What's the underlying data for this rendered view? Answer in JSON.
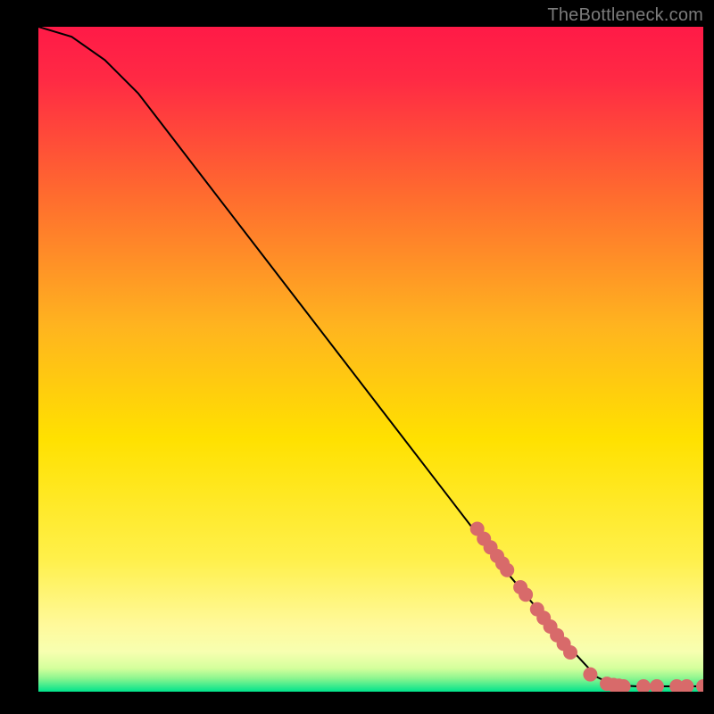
{
  "attribution": "TheBottleneck.com",
  "chart_data": {
    "type": "line",
    "title": "",
    "xlabel": "",
    "ylabel": "",
    "xlim": [
      0,
      100
    ],
    "ylim": [
      0,
      100
    ],
    "background": {
      "top_color": "#ff1a47",
      "mid_color": "#ffe100",
      "bottom_colors": [
        "#fff99b",
        "#b7f97a",
        "#00e38c"
      ]
    },
    "curve": {
      "description": "Monotonically decreasing curve from top-left to a flat plateau at bottom-right",
      "points": [
        {
          "x": 0.0,
          "y": 100.0
        },
        {
          "x": 5.0,
          "y": 98.5
        },
        {
          "x": 10.0,
          "y": 95.0
        },
        {
          "x": 15.0,
          "y": 90.0
        },
        {
          "x": 20.0,
          "y": 83.5
        },
        {
          "x": 30.0,
          "y": 70.5
        },
        {
          "x": 40.0,
          "y": 57.5
        },
        {
          "x": 50.0,
          "y": 44.5
        },
        {
          "x": 60.0,
          "y": 31.5
        },
        {
          "x": 70.0,
          "y": 18.5
        },
        {
          "x": 80.0,
          "y": 6.5
        },
        {
          "x": 84.0,
          "y": 2.2
        },
        {
          "x": 86.5,
          "y": 1.0
        },
        {
          "x": 90.0,
          "y": 0.8
        },
        {
          "x": 95.0,
          "y": 0.8
        },
        {
          "x": 100.0,
          "y": 0.8
        }
      ]
    },
    "markers": {
      "color": "#d86a6a",
      "radius_px": 8,
      "points": [
        {
          "x": 66.0,
          "y": 24.5
        },
        {
          "x": 67.0,
          "y": 23.0
        },
        {
          "x": 68.0,
          "y": 21.7
        },
        {
          "x": 69.0,
          "y": 20.4
        },
        {
          "x": 69.8,
          "y": 19.3
        },
        {
          "x": 70.5,
          "y": 18.3
        },
        {
          "x": 72.5,
          "y": 15.7
        },
        {
          "x": 73.3,
          "y": 14.6
        },
        {
          "x": 75.0,
          "y": 12.4
        },
        {
          "x": 76.0,
          "y": 11.1
        },
        {
          "x": 77.0,
          "y": 9.8
        },
        {
          "x": 78.0,
          "y": 8.5
        },
        {
          "x": 79.0,
          "y": 7.2
        },
        {
          "x": 80.0,
          "y": 5.9
        },
        {
          "x": 83.0,
          "y": 2.6
        },
        {
          "x": 85.5,
          "y": 1.2
        },
        {
          "x": 86.5,
          "y": 1.0
        },
        {
          "x": 87.3,
          "y": 0.9
        },
        {
          "x": 88.0,
          "y": 0.8
        },
        {
          "x": 91.0,
          "y": 0.8
        },
        {
          "x": 93.0,
          "y": 0.8
        },
        {
          "x": 96.0,
          "y": 0.8
        },
        {
          "x": 97.5,
          "y": 0.8
        },
        {
          "x": 100.0,
          "y": 0.8
        }
      ]
    }
  }
}
